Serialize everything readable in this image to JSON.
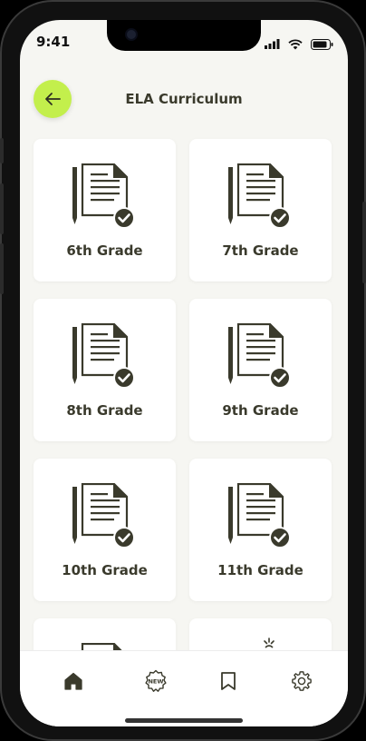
{
  "status_bar": {
    "time": "9:41"
  },
  "header": {
    "title": "ELA Curriculum",
    "back_icon": "arrow-left-icon"
  },
  "colors": {
    "accent": "#c3ef4c",
    "icon_dark": "#3a3a2c",
    "background": "#f6f6f2"
  },
  "grades": [
    {
      "label": "6th Grade",
      "icon": "document-check-icon"
    },
    {
      "label": "7th Grade",
      "icon": "document-check-icon"
    },
    {
      "label": "8th Grade",
      "icon": "document-check-icon"
    },
    {
      "label": "9th Grade",
      "icon": "document-check-icon"
    },
    {
      "label": "10th Grade",
      "icon": "document-check-icon"
    },
    {
      "label": "11th Grade",
      "icon": "document-check-icon"
    }
  ],
  "bottom_nav": [
    {
      "icon": "home-icon",
      "active": true
    },
    {
      "icon": "new-badge-icon",
      "active": false
    },
    {
      "icon": "bookmark-icon",
      "active": false
    },
    {
      "icon": "settings-icon",
      "active": false
    }
  ]
}
